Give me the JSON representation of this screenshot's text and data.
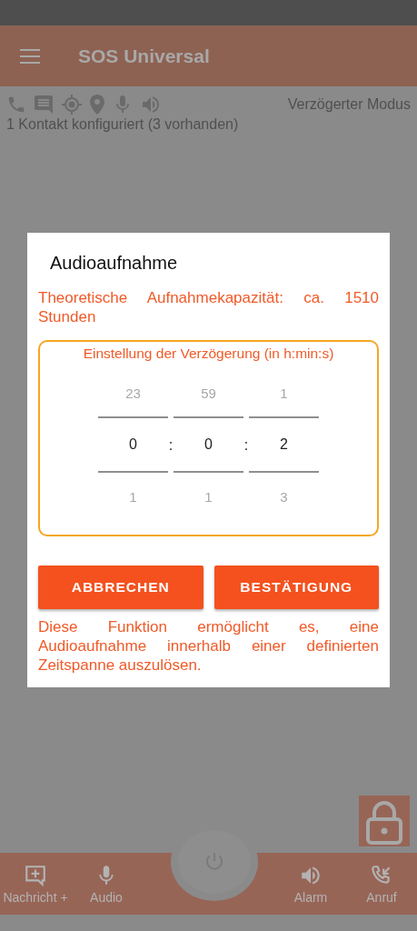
{
  "app_bar": {
    "title": "SOS Universal"
  },
  "status": {
    "mode": "Verzögerter Modus",
    "contacts": "1 Kontakt konfiguriert (3 vorhanden)"
  },
  "dialog": {
    "title": "Audioaufnahme",
    "capacity": "Theoretische Aufnahmekapazität: ca. 1510 Stunden",
    "picker": {
      "label": "Einstellung der Verzögerung (in h:min:s)",
      "columns": [
        {
          "above": "23",
          "value": "0",
          "below": "1"
        },
        {
          "above": "59",
          "value": "0",
          "below": "1"
        },
        {
          "above": "1",
          "value": "2",
          "below": "3"
        }
      ],
      "separators": [
        ":",
        ":"
      ]
    },
    "buttons": [
      "ABBRECHEN",
      "BESTÄTIGUNG"
    ],
    "description": "Diese Funktion ermöglicht es, eine Audioaufnahme innerhalb einer definierten Zeitspanne auszulösen."
  },
  "bottom_nav": [
    {
      "kind": "message",
      "label": "Nachricht +"
    },
    {
      "kind": "mic",
      "label": "Audio"
    },
    {
      "kind": "speaker",
      "label": "Alarm"
    },
    {
      "kind": "call",
      "label": "Anruf"
    }
  ]
}
